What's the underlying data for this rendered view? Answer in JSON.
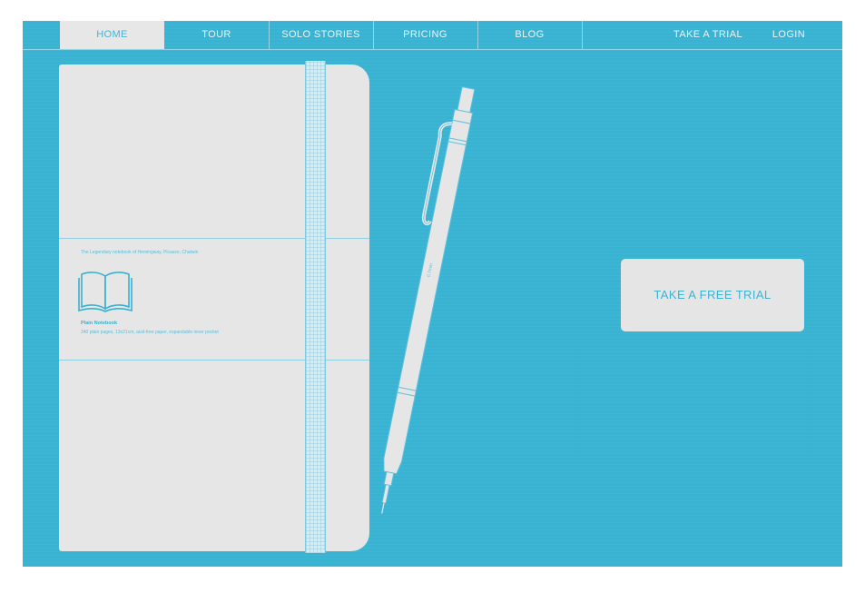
{
  "nav": {
    "items": [
      {
        "label": "HOME"
      },
      {
        "label": "TOUR"
      },
      {
        "label": "SOLO STORIES"
      },
      {
        "label": "PRICING"
      },
      {
        "label": "BLOG"
      }
    ],
    "trial_label": "TAKE A TRIAL",
    "login_label": "LOGIN"
  },
  "notebook": {
    "tagline": "The Legendary notebook of Hemingway, Picasso, Chatwin",
    "title": "Plain Notebook",
    "description": "240 plain pages, 13x21cm, acid-free paper, expandable inner pocket",
    "icon": "open-book-icon"
  },
  "pencil": {
    "lead_label": "0.7mm"
  },
  "cta": {
    "label": "TAKE A FREE TRIAL"
  },
  "colors": {
    "background": "#3ab3d3",
    "notebook": "#e6e6e6",
    "accent": "#42b5d5"
  }
}
